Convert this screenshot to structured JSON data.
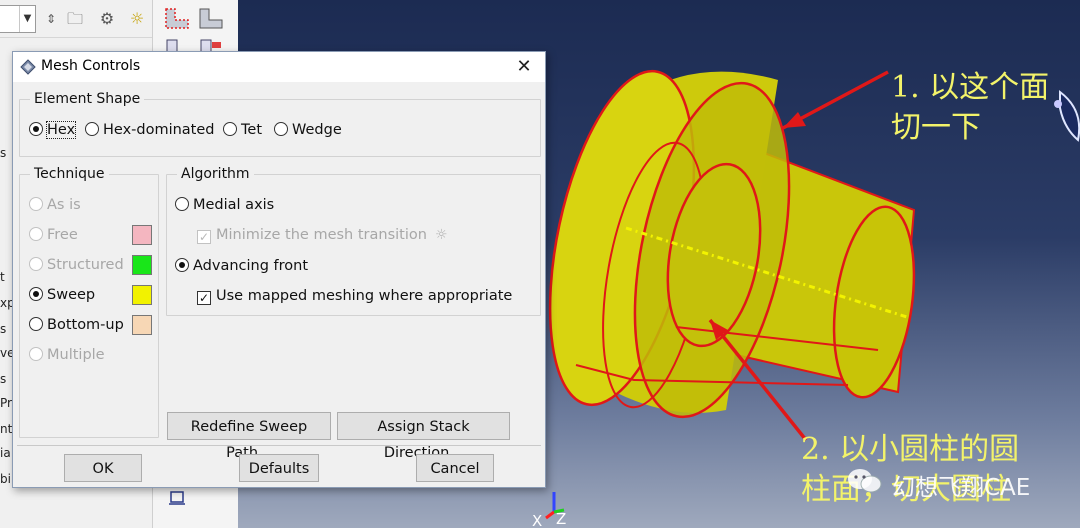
{
  "background_app": {
    "tree_fragments": [
      "s",
      "t",
      "xp",
      "s",
      "ve",
      "s",
      "Pr",
      "nt",
      "ia",
      "bi"
    ],
    "triad_axes": [
      "X",
      "Z"
    ]
  },
  "dialog": {
    "title": "Mesh Controls",
    "close_glyph": "✕",
    "element_shape": {
      "label": "Element Shape",
      "options": [
        "Hex",
        "Hex-dominated",
        "Tet",
        "Wedge"
      ],
      "selected": "Hex"
    },
    "technique": {
      "label": "Technique",
      "options": [
        {
          "label": "As is",
          "enabled": false,
          "swatch": null
        },
        {
          "label": "Free",
          "enabled": false,
          "swatch": "#f4b6c0"
        },
        {
          "label": "Structured",
          "enabled": false,
          "swatch": "#19e619"
        },
        {
          "label": "Sweep",
          "enabled": true,
          "swatch": "#f2f200"
        },
        {
          "label": "Bottom-up",
          "enabled": true,
          "swatch": "#f7d7b5"
        },
        {
          "label": "Multiple",
          "enabled": false,
          "swatch": null
        }
      ],
      "selected": "Sweep"
    },
    "algorithm": {
      "label": "Algorithm",
      "medial_axis": "Medial axis",
      "minimize_transition": "Minimize the mesh transition",
      "advancing_front": "Advancing front",
      "use_mapped": "Use mapped meshing where appropriate",
      "selected": "Advancing front",
      "minimize_checked": true,
      "use_mapped_checked": true
    },
    "buttons": {
      "redefine_sweep": "Redefine Sweep Path...",
      "assign_stack": "Assign Stack Direction...",
      "ok": "OK",
      "defaults": "Defaults",
      "cancel": "Cancel"
    }
  },
  "annotations": {
    "note1_line1": "1. 以这个面",
    "note1_line2": "切一下",
    "note2_line1": "2. 以小圆柱的圆",
    "note2_line2": "柱面，切大圆柱",
    "watermark": "幻想飞翔CAE"
  },
  "colors": {
    "model_fill": "#d8d400",
    "model_edge": "#e01818",
    "annotation_text": "#f3f36a",
    "axis_line": "#f3f300"
  }
}
